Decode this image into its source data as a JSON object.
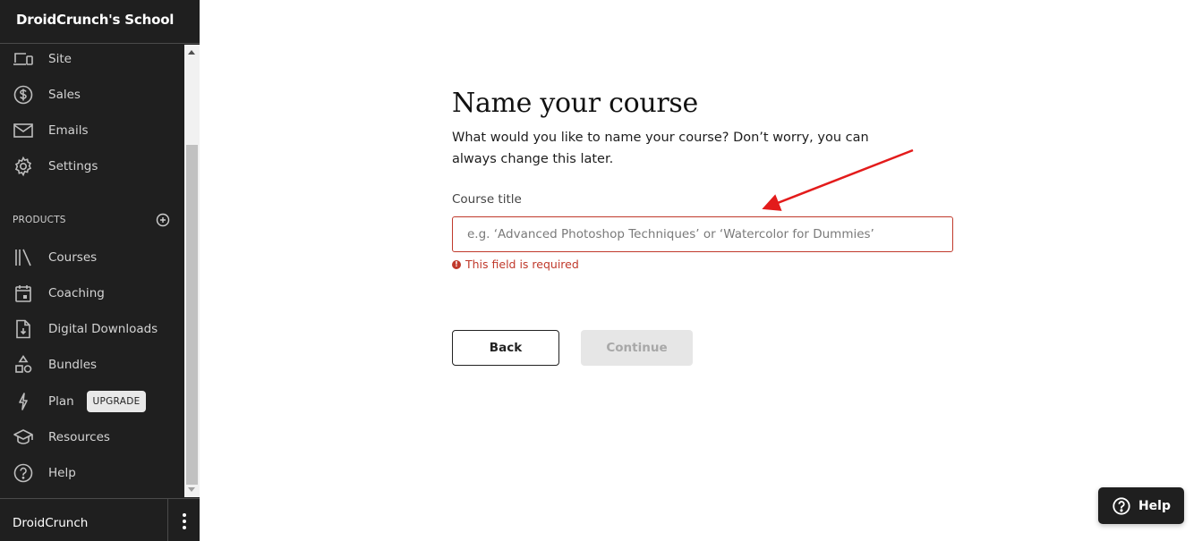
{
  "sidebar": {
    "school_title": "DroidCrunch's School",
    "items_top": [
      {
        "label": "Site",
        "icon": "devices-icon"
      },
      {
        "label": "Sales",
        "icon": "dollar-circle-icon"
      },
      {
        "label": "Emails",
        "icon": "mail-icon"
      },
      {
        "label": "Settings",
        "icon": "gear-icon"
      }
    ],
    "products_section": {
      "label": "PRODUCTS",
      "add_icon": "plus-circle-icon"
    },
    "items_products": [
      {
        "label": "Courses",
        "icon": "library-icon"
      },
      {
        "label": "Coaching",
        "icon": "calendar-icon"
      },
      {
        "label": "Digital Downloads",
        "icon": "file-download-icon"
      },
      {
        "label": "Bundles",
        "icon": "shapes-icon"
      },
      {
        "label": "Plan",
        "icon": "lightning-icon",
        "badge": "UPGRADE"
      },
      {
        "label": "Resources",
        "icon": "graduation-cap-icon"
      },
      {
        "label": "Help",
        "icon": "question-circle-icon"
      }
    ],
    "footer": {
      "user_name": "DroidCrunch",
      "menu_icon": "kebab-menu-icon"
    }
  },
  "main": {
    "title": "Name your course",
    "description": "What would you like to name your course? Don’t worry, you can always change this later.",
    "field": {
      "label": "Course title",
      "value": "",
      "placeholder": "e.g. ‘Advanced Photoshop Techniques’ or ‘Watercolor for Dummies’",
      "error": "This field is required"
    },
    "buttons": {
      "back": "Back",
      "continue": "Continue"
    }
  },
  "help_widget": {
    "label": "Help"
  },
  "colors": {
    "sidebar_bg": "#1f1f1f",
    "error": "#c0392b",
    "annotation_arrow": "#e31b1b",
    "disabled_button_bg": "#e6e6e6"
  }
}
